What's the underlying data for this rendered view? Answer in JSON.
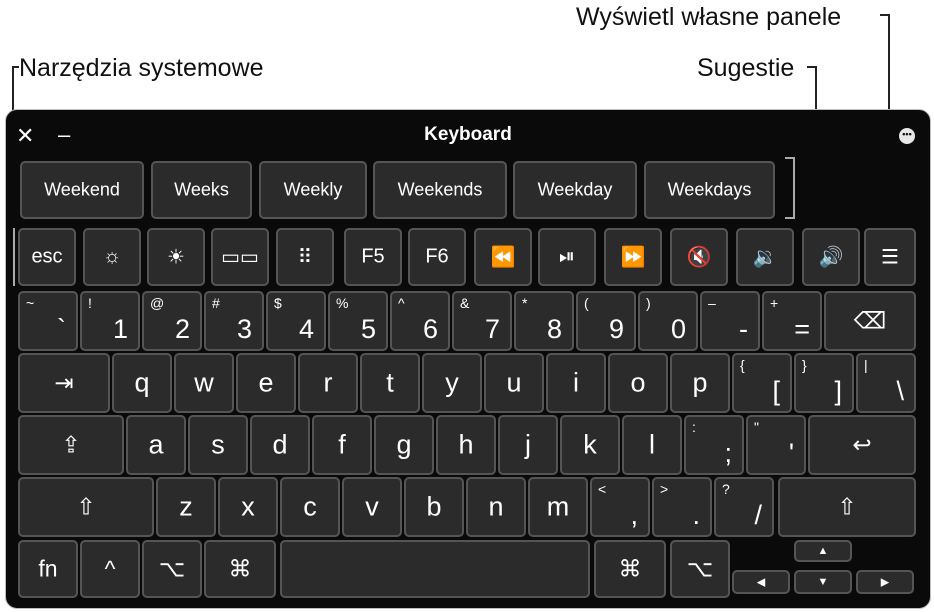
{
  "callouts": {
    "system_tools": "Narzędzia systemowe",
    "custom_panels": "Wyświetl własne panele",
    "suggestions": "Sugestie"
  },
  "window": {
    "title": "Keyboard",
    "close_glyph": "✕",
    "minimize_glyph": "–",
    "more_glyph": "•••"
  },
  "suggestions": [
    "Weekend",
    "Weeks",
    "Weekly",
    "Weekends",
    "Weekday",
    "Weekdays"
  ],
  "function_row": {
    "esc": "esc",
    "brightness_down": "☼",
    "brightness_up": "☀",
    "mission_control": "▭▭",
    "launchpad": "⠿",
    "f5": "F5",
    "f6": "F6",
    "rewind": "⏪",
    "play_pause": "⏯",
    "fast_forward": "⏩",
    "mute": "🔇",
    "volume_down": "🔉",
    "volume_up": "🔊",
    "panels": "☰"
  },
  "number_row": [
    {
      "shift": "~",
      "main": "`"
    },
    {
      "shift": "!",
      "main": "1"
    },
    {
      "shift": "@",
      "main": "2"
    },
    {
      "shift": "#",
      "main": "3"
    },
    {
      "shift": "$",
      "main": "4"
    },
    {
      "shift": "%",
      "main": "5"
    },
    {
      "shift": "^",
      "main": "6"
    },
    {
      "shift": "&",
      "main": "7"
    },
    {
      "shift": "*",
      "main": "8"
    },
    {
      "shift": "(",
      "main": "9"
    },
    {
      "shift": ")",
      "main": "0"
    },
    {
      "shift": "–",
      "main": "-"
    },
    {
      "shift": "+",
      "main": "="
    }
  ],
  "delete_glyph": "⌫",
  "tab_glyph": "⇥",
  "row_q": [
    "q",
    "w",
    "e",
    "r",
    "t",
    "y",
    "u",
    "i",
    "o",
    "p"
  ],
  "row_q_symbols": [
    {
      "shift": "{",
      "main": "["
    },
    {
      "shift": "}",
      "main": "]"
    },
    {
      "shift": "|",
      "main": "\\"
    }
  ],
  "caps_glyph": "⇪",
  "row_a": [
    "a",
    "s",
    "d",
    "f",
    "g",
    "h",
    "j",
    "k",
    "l"
  ],
  "row_a_symbols": [
    {
      "shift": ":",
      "main": ";"
    },
    {
      "shift": "\"",
      "main": "'"
    }
  ],
  "return_glyph": "↩",
  "shift_glyph": "⇧",
  "row_z": [
    "z",
    "x",
    "c",
    "v",
    "b",
    "n",
    "m"
  ],
  "row_z_symbols": [
    {
      "shift": "<",
      "main": ","
    },
    {
      "shift": ">",
      "main": "."
    },
    {
      "shift": "?",
      "main": "/"
    }
  ],
  "bottom_row": {
    "fn": "fn",
    "control": "^",
    "option": "⌥",
    "command": "⌘",
    "space": "",
    "arrow_up": "▲",
    "arrow_left": "◀",
    "arrow_down": "▼",
    "arrow_right": "▶"
  }
}
